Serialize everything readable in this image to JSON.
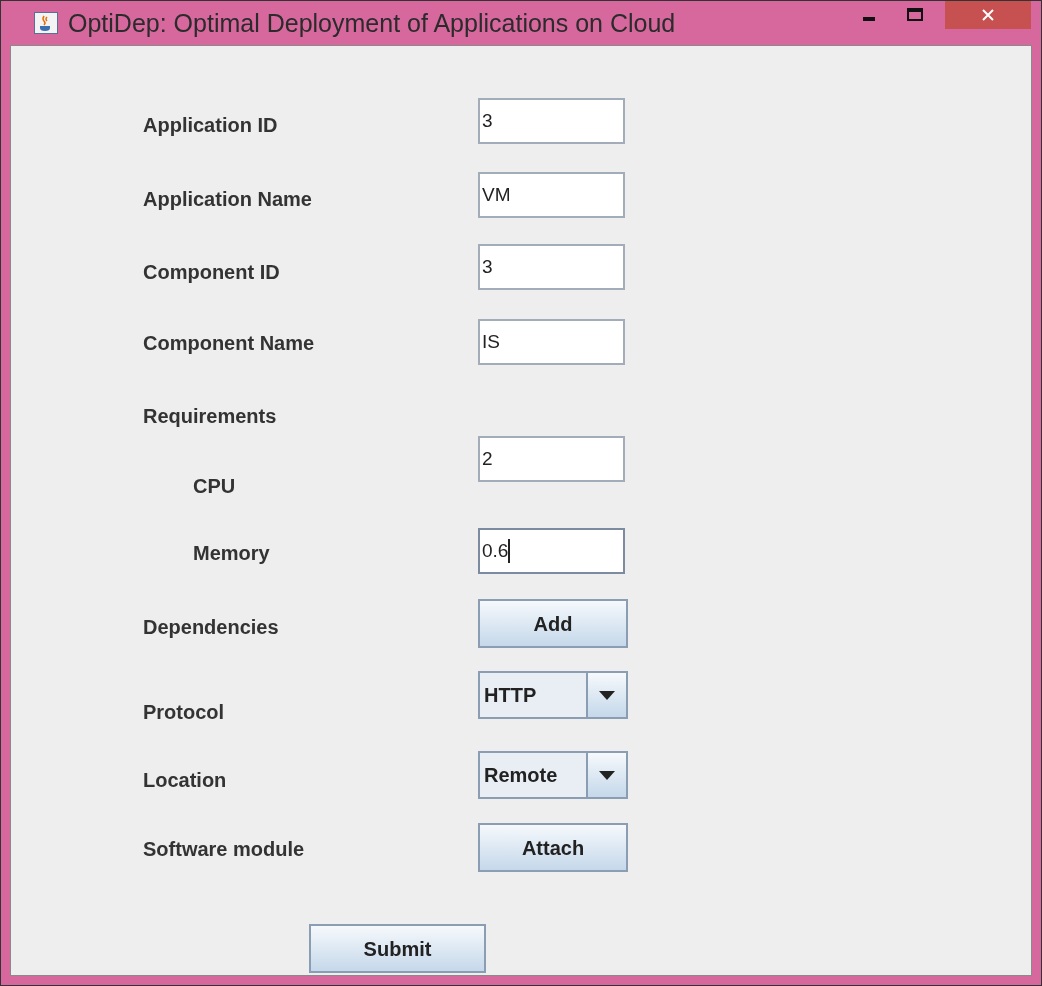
{
  "window": {
    "title": "OptiDep: Optimal Deployment of Applications on Cloud"
  },
  "rows": [
    {
      "kind": "field",
      "label": "Application ID",
      "value": "3",
      "focused": false
    },
    {
      "kind": "field",
      "label": "Application Name",
      "value": "VM",
      "focused": false
    },
    {
      "kind": "field",
      "label": "Component ID",
      "value": "3",
      "focused": false
    },
    {
      "kind": "field",
      "label": "Component Name",
      "value": "IS",
      "focused": false
    },
    {
      "kind": "heading",
      "label": "Requirements",
      "children": [
        {
          "kind": "field",
          "label": "CPU",
          "value": "2",
          "focused": false
        },
        {
          "kind": "field",
          "label": "Memory",
          "value": "0.6",
          "focused": true
        }
      ]
    },
    {
      "kind": "button",
      "label": "Dependencies",
      "button": "Add"
    },
    {
      "kind": "combo",
      "label": "Protocol",
      "value": "HTTP"
    },
    {
      "kind": "combo",
      "label": "Location",
      "value": "Remote"
    },
    {
      "kind": "button",
      "label": "Software module",
      "button": "Attach"
    }
  ],
  "submit": "Submit"
}
